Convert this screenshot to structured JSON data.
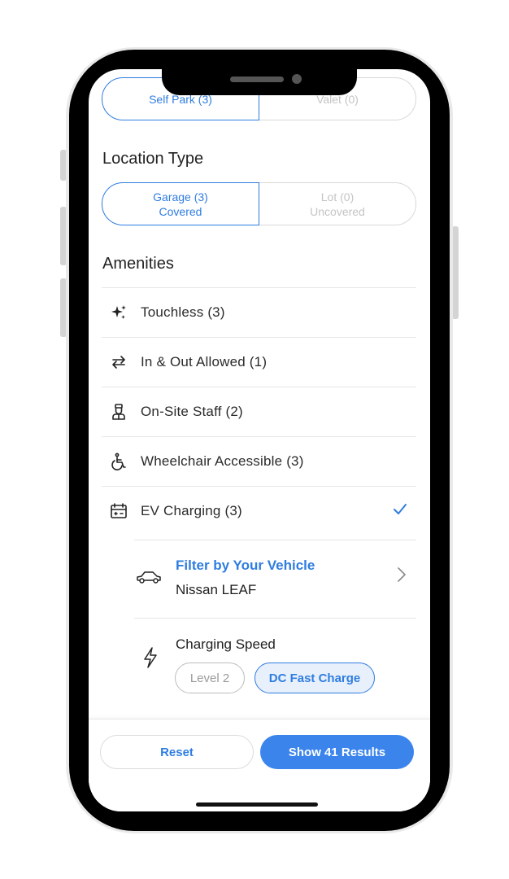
{
  "parking_type": {
    "options": [
      {
        "label": "Self Park (3)",
        "sub": ""
      },
      {
        "label": "Valet (0)",
        "sub": ""
      }
    ]
  },
  "location_type": {
    "title": "Location Type",
    "options": [
      {
        "label": "Garage (3)",
        "sub": "Covered"
      },
      {
        "label": "Lot (0)",
        "sub": "Uncovered"
      }
    ]
  },
  "amenities": {
    "title": "Amenities",
    "items": [
      {
        "label": "Touchless (3)",
        "icon": "sparkle-icon"
      },
      {
        "label": "In & Out Allowed (1)",
        "icon": "swap-arrows-icon"
      },
      {
        "label": "On-Site Staff (2)",
        "icon": "attendant-icon"
      },
      {
        "label": "Wheelchair Accessible (3)",
        "icon": "wheelchair-icon"
      },
      {
        "label": "EV Charging (3)",
        "icon": "ev-charger-icon",
        "checked": true
      }
    ]
  },
  "ev": {
    "vehicle_title": "Filter by Your Vehicle",
    "vehicle_name": "Nissan LEAF",
    "speed_title": "Charging Speed",
    "speeds": [
      {
        "label": "Level 2",
        "selected": false
      },
      {
        "label": "DC Fast Charge",
        "selected": true
      }
    ]
  },
  "footer": {
    "reset_label": "Reset",
    "show_label": "Show 41 Results"
  },
  "colors": {
    "accent": "#2f7de1",
    "primary_button": "#3a84ec",
    "divider": "#e6e6e6"
  }
}
